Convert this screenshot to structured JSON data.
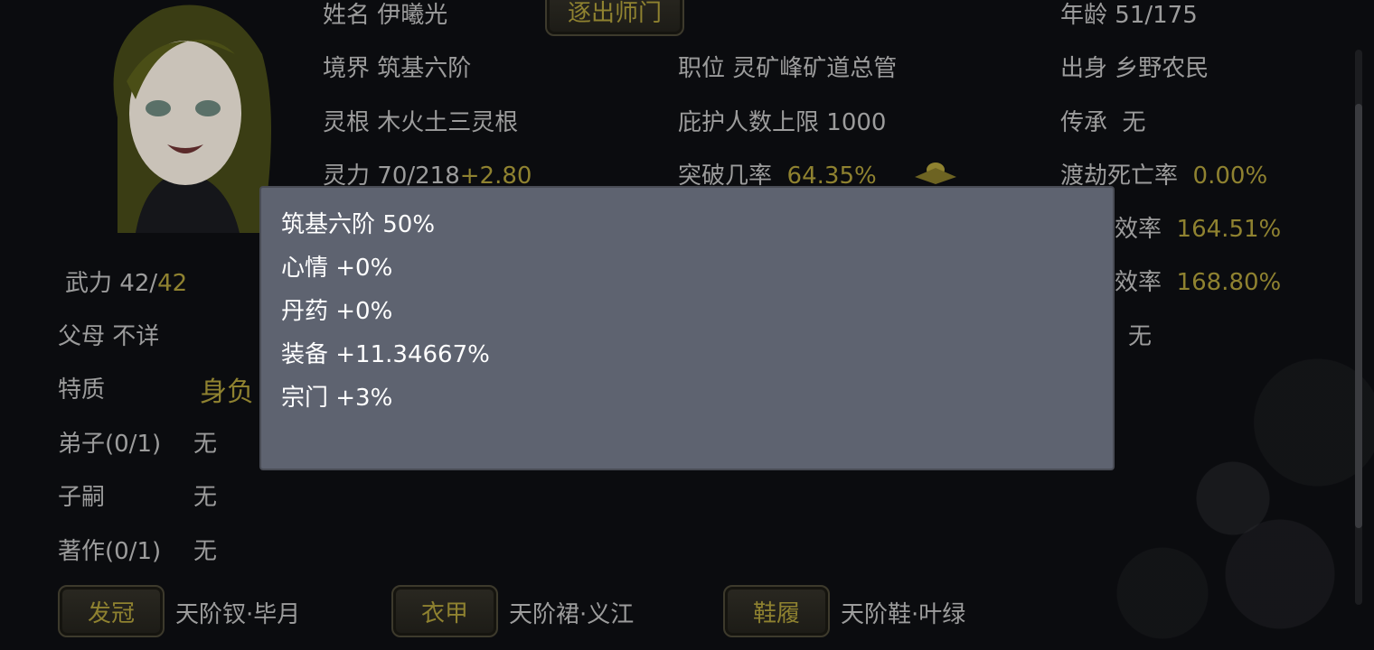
{
  "character": {
    "name_label": "姓名",
    "name": "伊曦光",
    "expel_button": "逐出师门",
    "age_label": "年龄",
    "age": "51/175",
    "realm_label": "境界",
    "realm": "筑基六阶",
    "position_label": "职位",
    "position": "灵矿峰矿道总管",
    "origin_label": "出身",
    "origin": "乡野农民",
    "root_label": "灵根",
    "root": "木火土三灵根",
    "protect_label": "庇护人数上限",
    "protect": "1000",
    "inherit_label": "传承",
    "inherit": "无",
    "power_label": "灵力",
    "power": "70/218",
    "power_rate": "+2.80",
    "breakthrough_label": "突破几率",
    "breakthrough": "64.35%",
    "tribulation_label": "渡劫死亡率",
    "tribulation": "0.00%",
    "efficiency1_label_tail": "效率",
    "efficiency1": "164.51%",
    "efficiency2_label_tail": "效率",
    "efficiency2": "168.80%",
    "other_value": "无",
    "force_label": "武力",
    "force_current": "42",
    "force_max": "42",
    "parents_label": "父母",
    "parents": "不详",
    "trait_label": "特质",
    "trait_partial": "身负",
    "disciples_label": "弟子(0/1)",
    "disciples": "无",
    "heirs_label": "子嗣",
    "heirs": "无",
    "works_label": "著作(0/1)",
    "works": "无"
  },
  "equipment": [
    {
      "slot": "发冠",
      "item": "天阶钗·毕月"
    },
    {
      "slot": "衣甲",
      "item": "天阶裙·义江"
    },
    {
      "slot": "鞋履",
      "item": "天阶鞋·叶绿"
    }
  ],
  "popup": {
    "lines": [
      "筑基六阶 50%",
      "心情 +0%",
      "丹药 +0%",
      "装备 +11.34667%",
      "宗门 +3%"
    ]
  },
  "colors": {
    "background": "#0b0c0f",
    "gold": "#8f8230",
    "popup_bg": "#5e6370"
  }
}
